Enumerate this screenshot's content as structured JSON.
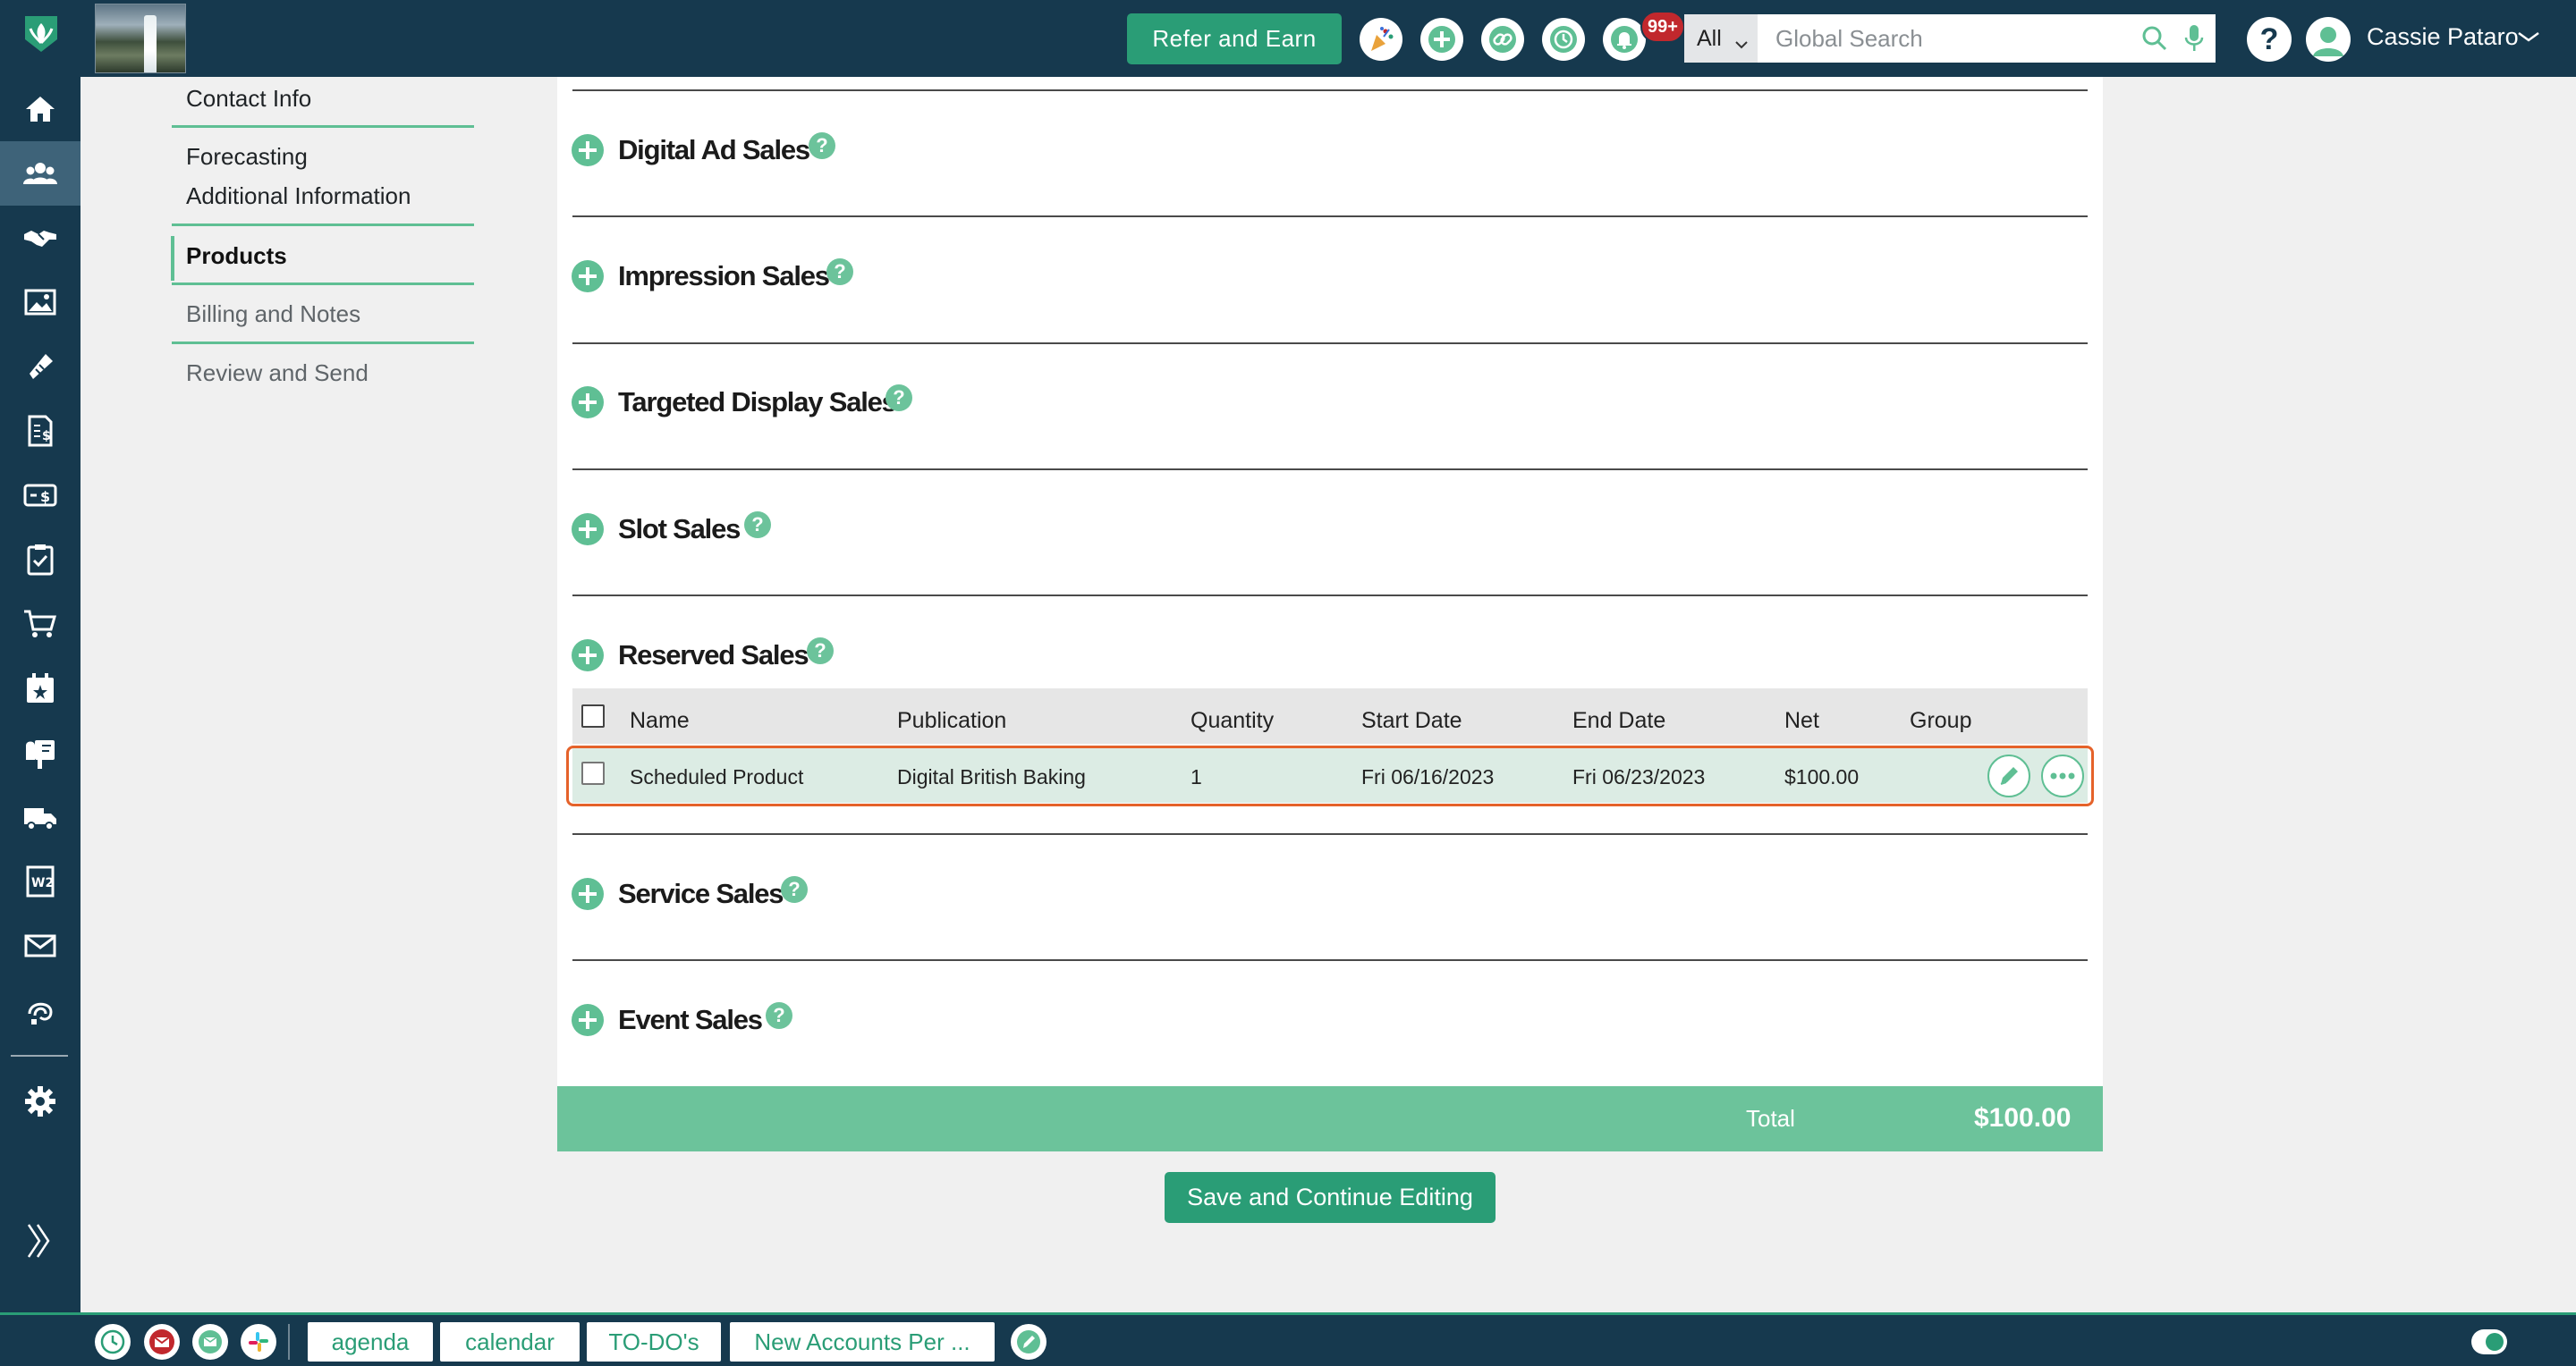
{
  "topbar": {
    "refer_button": "Refer and Earn",
    "notification_count": "99+",
    "search_scope": "All",
    "search_placeholder": "Global Search",
    "help_label": "?",
    "user_name": "Cassie Pataro"
  },
  "sidebar": {
    "items": [
      "home-icon",
      "contacts-icon",
      "deals-icon",
      "gallery-icon",
      "tickets-icon",
      "invoice-icon",
      "payments-icon",
      "tasks-icon",
      "cart-icon",
      "events-icon",
      "mailbox-icon",
      "delivery-icon",
      "w2-icon",
      "mail-icon",
      "support-icon",
      "gear-icon"
    ],
    "active_item": "contacts-icon"
  },
  "section_nav": {
    "items": [
      "Contact Info",
      "Forecasting",
      "Additional Information",
      "Products",
      "Billing and Notes",
      "Review and Send"
    ],
    "active": "Products"
  },
  "sections": [
    {
      "title": "Digital Ad Sales"
    },
    {
      "title": "Impression Sales"
    },
    {
      "title": "Targeted Display Sales"
    },
    {
      "title": "Slot Sales"
    },
    {
      "title": "Reserved Sales"
    },
    {
      "title": "Service Sales"
    },
    {
      "title": "Event Sales"
    }
  ],
  "reserved_table": {
    "columns": [
      "Name",
      "Publication",
      "Quantity",
      "Start Date",
      "End Date",
      "Net",
      "Group"
    ],
    "rows": [
      {
        "name": "Scheduled Product",
        "publication": "Digital British Baking",
        "quantity": "1",
        "start_date": "Fri 06/16/2023",
        "end_date": "Fri 06/23/2023",
        "net": "$100.00",
        "group": ""
      }
    ]
  },
  "total": {
    "label": "Total",
    "value": "$100.00"
  },
  "save_button": "Save and Continue Editing",
  "bottombar": {
    "tabs": [
      "agenda",
      "calendar",
      "TO-DO's",
      "New Accounts Per ..."
    ]
  },
  "colors": {
    "navy": "#16394e",
    "green": "#2a9d76",
    "light_green": "#6cc39b",
    "highlight": "#e5622a",
    "badge_red": "#c1282d"
  }
}
